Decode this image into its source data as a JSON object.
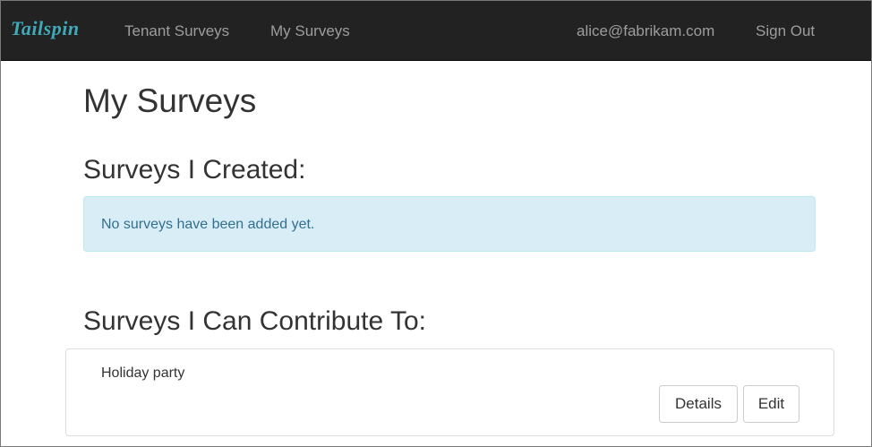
{
  "navbar": {
    "brand": "Tailspin",
    "links": [
      {
        "label": "Tenant Surveys"
      },
      {
        "label": "My Surveys"
      }
    ],
    "user_email": "alice@fabrikam.com",
    "sign_out_label": "Sign Out"
  },
  "page": {
    "title": "My Surveys",
    "created_heading": "Surveys I Created:",
    "created_empty_message": "No surveys have been added yet.",
    "contribute_heading": "Surveys I Can Contribute To:",
    "contribute_surveys": [
      {
        "title": "Holiday party",
        "details_label": "Details",
        "edit_label": "Edit"
      }
    ]
  },
  "colors": {
    "navbar_bg": "#222222",
    "brand": "#3fa9b8",
    "nav_link": "#9d9d9d",
    "alert_bg": "#d9edf7",
    "alert_text": "#31708f"
  }
}
